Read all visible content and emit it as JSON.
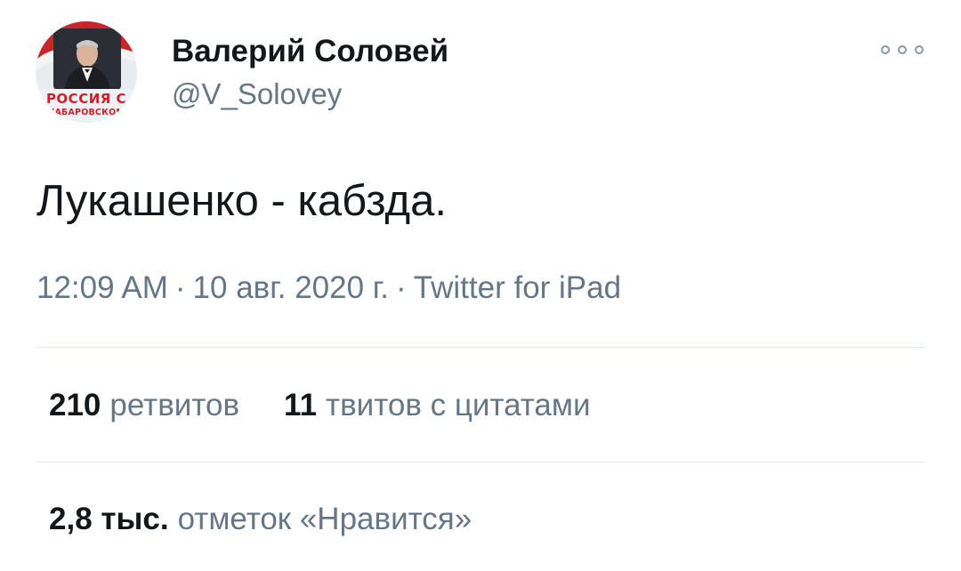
{
  "author": {
    "display_name": "Валерий Соловей",
    "handle": "@V_Solovey",
    "avatar": {
      "caption_line1": "РОССИЯ С",
      "caption_line2": "ХАБАРОВСКОМ"
    }
  },
  "tweet": {
    "text": "Лукашенко - кабзда.",
    "time": "12:09 AM",
    "date": "10 авг. 2020 г.",
    "source": "Twitter for iPad",
    "separator": "·"
  },
  "stats": {
    "retweets_count": "210",
    "retweets_label": "ретвитов",
    "quotes_count": "11",
    "quotes_label": "твитов с цитатами",
    "likes_count": "2,8 тыс.",
    "likes_label": "отметок «Нравится»"
  },
  "icons": {
    "more": "more-options-icon"
  },
  "colors": {
    "text_primary": "#14171a",
    "text_secondary": "#657786",
    "divider": "#e1e8ed",
    "avatar_caption": "#d21f26"
  }
}
